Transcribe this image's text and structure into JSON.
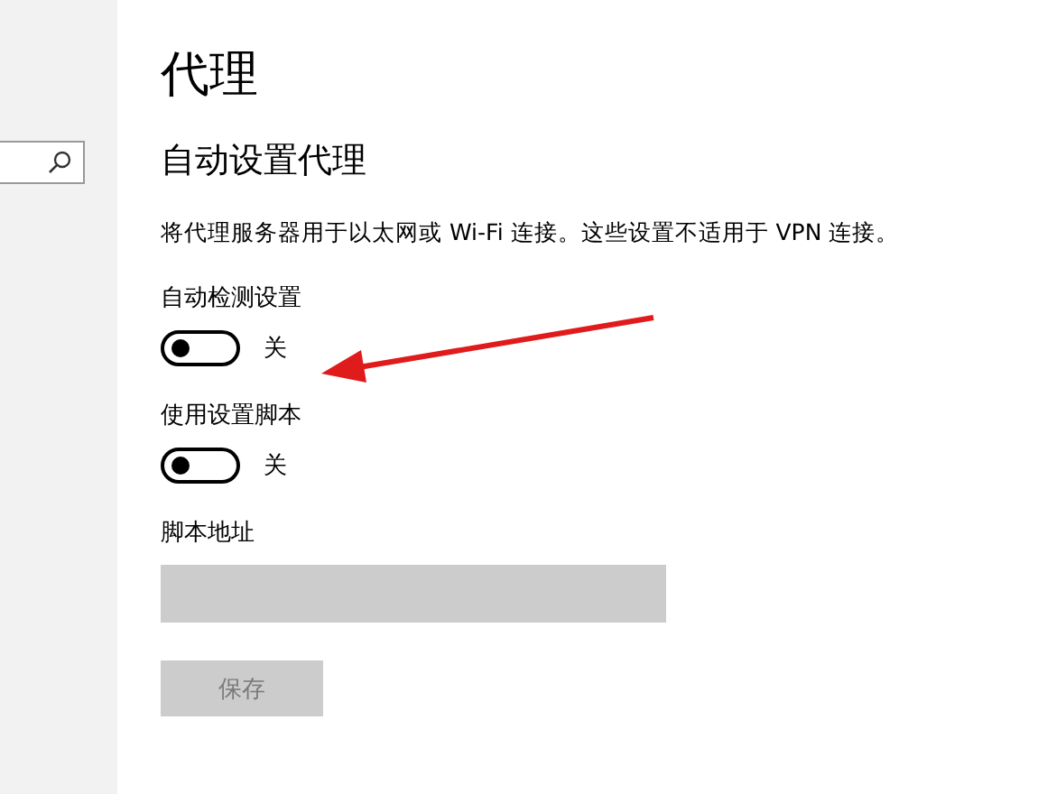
{
  "page": {
    "title": "代理",
    "section_title": "自动设置代理",
    "description": "将代理服务器用于以太网或 Wi-Fi 连接。这些设置不适用于 VPN 连接。"
  },
  "settings": [
    {
      "kind": "toggle",
      "label": "自动检测设置",
      "on": false,
      "state_text": "关"
    },
    {
      "kind": "toggle",
      "label": "使用设置脚本",
      "on": false,
      "state_text": "关"
    },
    {
      "kind": "field",
      "label": "脚本地址",
      "disabled": true
    }
  ],
  "save_button": {
    "label": "保存",
    "disabled": true
  }
}
